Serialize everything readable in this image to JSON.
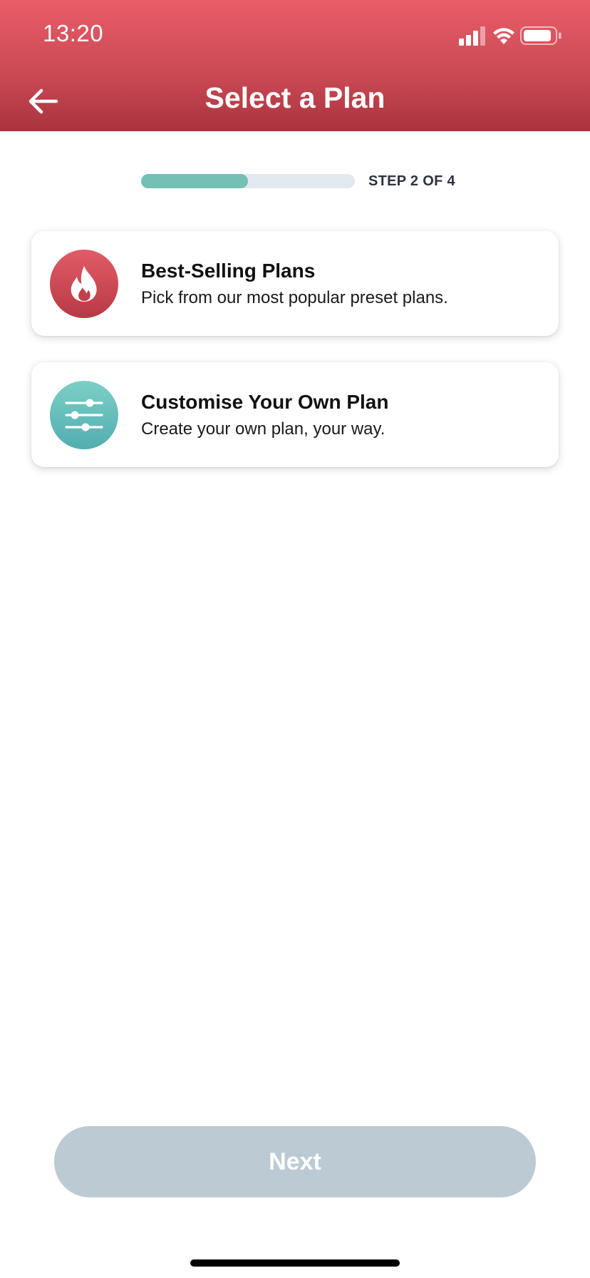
{
  "status_bar": {
    "time": "13:20",
    "icons": [
      "cellular-signal-icon",
      "wifi-icon",
      "battery-icon"
    ]
  },
  "header": {
    "title": "Select a Plan",
    "back_icon": "arrow-left-icon"
  },
  "progress": {
    "label": "STEP 2 OF 4",
    "fraction": 0.5
  },
  "plans": [
    {
      "title": "Best-Selling Plans",
      "description": "Pick from our most popular preset plans.",
      "icon": "flame-icon"
    },
    {
      "title": "Customise Your Own Plan",
      "description": "Create your own plan, your way.",
      "icon": "sliders-icon"
    }
  ],
  "footer": {
    "next_label": "Next"
  },
  "colors": {
    "header_red": "#d04b57",
    "progress_fill": "#74c0b5",
    "progress_track": "#e2eaf1",
    "icon_red": "#c94450",
    "icon_teal": "#64bcb9",
    "next_disabled": "#bccad4"
  }
}
